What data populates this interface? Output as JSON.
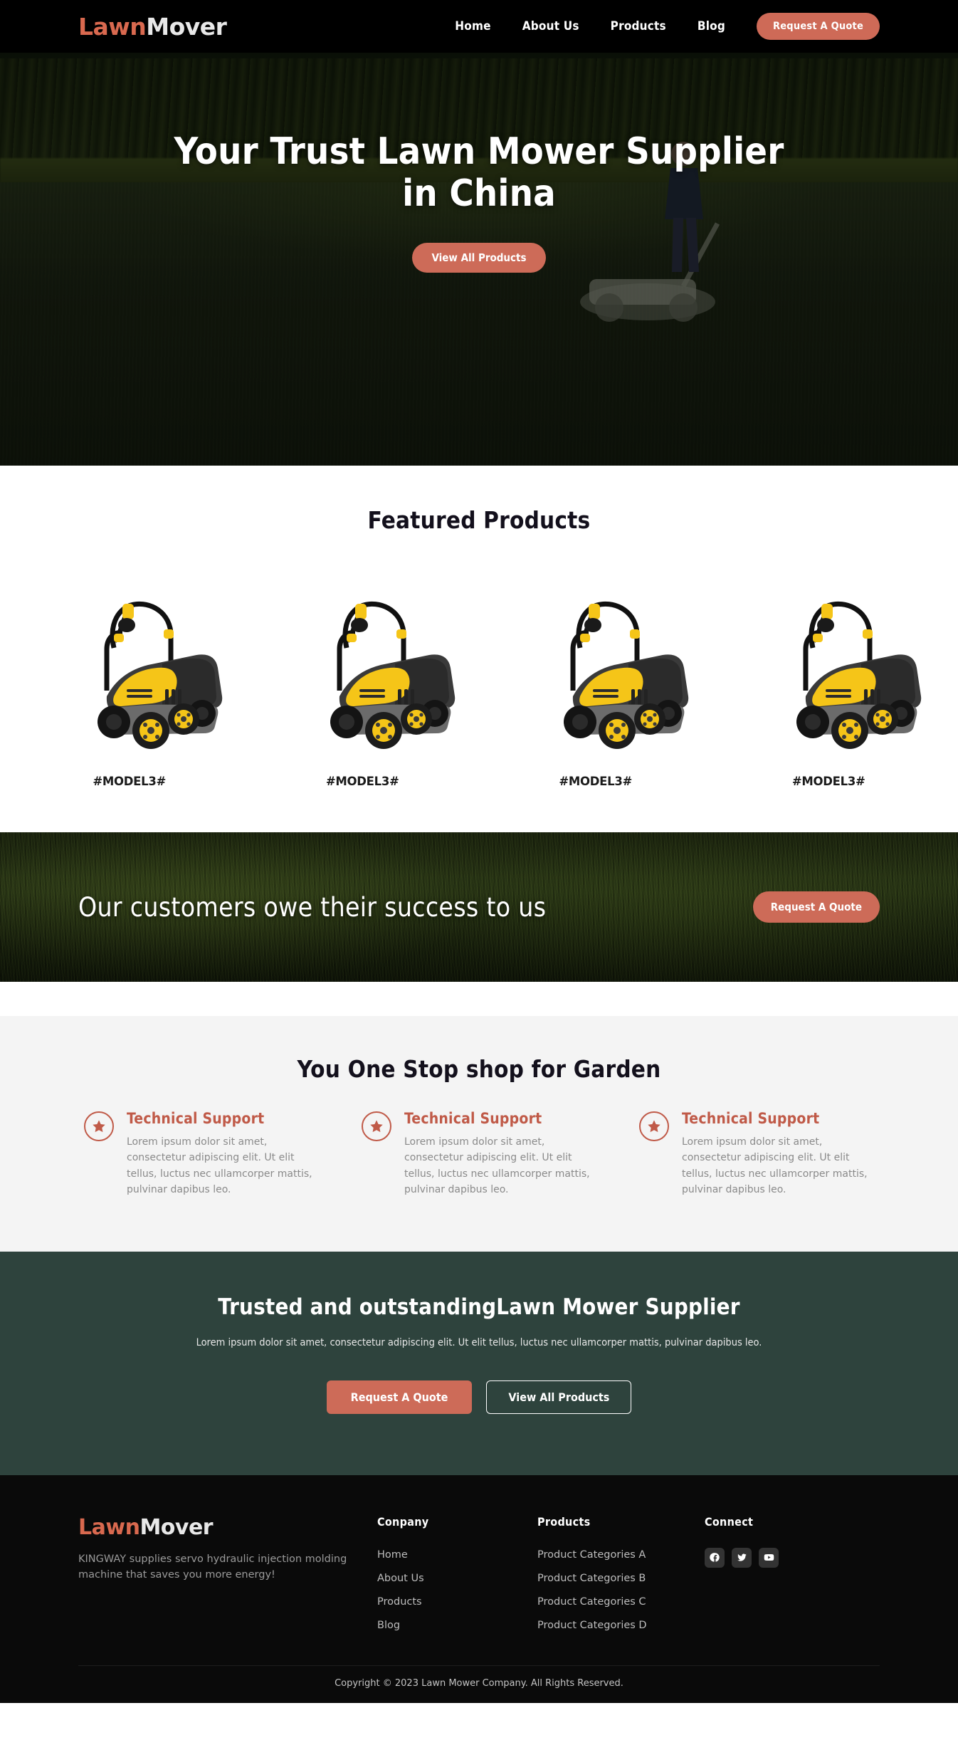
{
  "brand": {
    "part1": "Lawn",
    "part2": "Mover",
    "accent_color": "#d9694f"
  },
  "nav": {
    "links": [
      {
        "label": "Home"
      },
      {
        "label": "About Us"
      },
      {
        "label": "Products"
      },
      {
        "label": "Blog"
      }
    ],
    "cta_label": "Request A Quote"
  },
  "hero": {
    "title": "Your Trust Lawn Mower Supplier in China",
    "cta_label": "View All Products"
  },
  "featured": {
    "title": "Featured Products",
    "products": [
      {
        "name": "#MODEL3#"
      },
      {
        "name": "#MODEL3#"
      },
      {
        "name": "#MODEL3#"
      },
      {
        "name": "#MODEL3#"
      }
    ]
  },
  "cta_banner": {
    "text": "Our customers owe their success to us",
    "button_label": "Request A Quote"
  },
  "services": {
    "title": "You One Stop shop for Garden",
    "items": [
      {
        "icon": "star-icon",
        "title": "Technical Support",
        "body": "Lorem ipsum dolor sit amet, consectetur adipiscing elit. Ut elit tellus, luctus nec ullamcorper mattis, pulvinar dapibus leo."
      },
      {
        "icon": "star-icon",
        "title": "Technical Support",
        "body": "Lorem ipsum dolor sit amet, consectetur adipiscing elit. Ut elit tellus, luctus nec ullamcorper mattis, pulvinar dapibus leo."
      },
      {
        "icon": "star-icon",
        "title": "Technical Support",
        "body": "Lorem ipsum dolor sit amet, consectetur adipiscing elit. Ut elit tellus, luctus nec ullamcorper mattis, pulvinar dapibus leo."
      }
    ]
  },
  "trusted": {
    "title": "Trusted and outstandingLawn Mower Supplier",
    "subtitle": "Lorem ipsum dolor sit amet, consectetur adipiscing elit. Ut elit tellus, luctus nec ullamcorper mattis, pulvinar dapibus leo.",
    "primary_button": "Request A Quote",
    "secondary_button": "View All Products",
    "background_color": "#2e433d"
  },
  "footer": {
    "description": "KINGWAY supplies servo hydraulic injection molding machine that saves you more energy!",
    "company": {
      "heading": "Conpany",
      "links": [
        {
          "label": "Home"
        },
        {
          "label": "About Us"
        },
        {
          "label": "Products"
        },
        {
          "label": "Blog"
        }
      ]
    },
    "products": {
      "heading": "Products",
      "links": [
        {
          "label": "Product Categories A"
        },
        {
          "label": "Product Categories B"
        },
        {
          "label": "Product Categories C"
        },
        {
          "label": "Product Categories D"
        }
      ]
    },
    "connect": {
      "heading": "Connect",
      "socials": [
        {
          "name": "facebook-icon"
        },
        {
          "name": "twitter-icon"
        },
        {
          "name": "youtube-icon"
        }
      ]
    },
    "copyright": "Copyright © 2023 Lawn Mower Company. All Rights Reserved."
  }
}
